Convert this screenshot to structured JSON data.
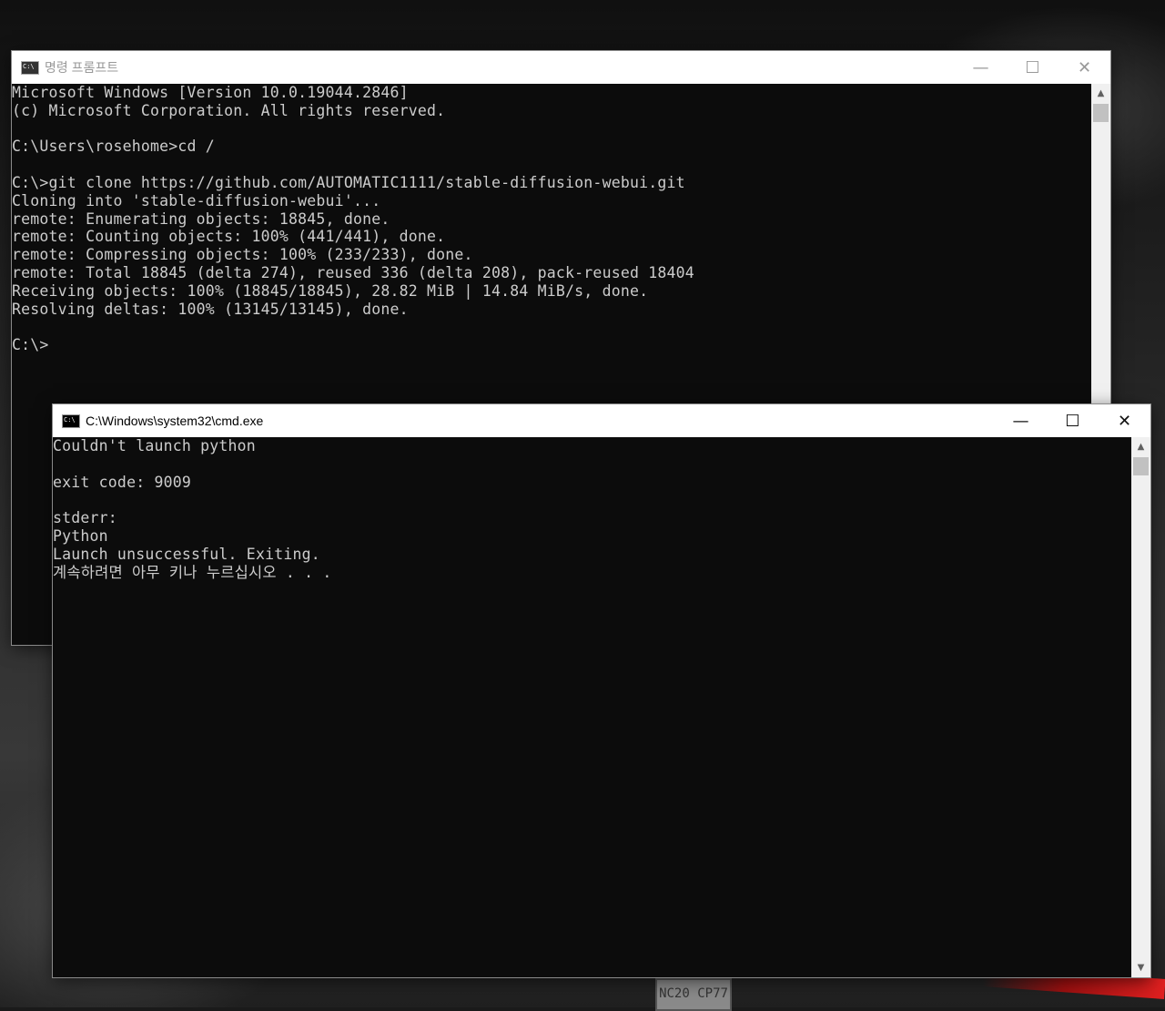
{
  "back_window": {
    "title": "명령 프롬프트",
    "controls": {
      "minimize": "—",
      "maximize": "☐",
      "close": "✕"
    },
    "lines": [
      "Microsoft Windows [Version 10.0.19044.2846]",
      "(c) Microsoft Corporation. All rights reserved.",
      "",
      "C:\\Users\\rosehome>cd /",
      "",
      "C:\\>git clone https://github.com/AUTOMATIC1111/stable-diffusion-webui.git",
      "Cloning into 'stable-diffusion-webui'...",
      "remote: Enumerating objects: 18845, done.",
      "remote: Counting objects: 100% (441/441), done.",
      "remote: Compressing objects: 100% (233/233), done.",
      "remote: Total 18845 (delta 274), reused 336 (delta 208), pack-reused 18404",
      "Receiving objects: 100% (18845/18845), 28.82 MiB | 14.84 MiB/s, done.",
      "Resolving deltas: 100% (13145/13145), done.",
      "",
      "C:\\>"
    ]
  },
  "front_window": {
    "title": "C:\\Windows\\system32\\cmd.exe",
    "controls": {
      "minimize": "—",
      "maximize": "☐",
      "close": "✕"
    },
    "lines": [
      "Couldn't launch python",
      "",
      "exit code: 9009",
      "",
      "stderr:",
      "Python",
      "Launch unsuccessful. Exiting.",
      "계속하려면 아무 키나 누르십시오 . . ."
    ]
  },
  "scrollbar": {
    "up_arrow": "▲",
    "down_arrow": "▼"
  },
  "background": {
    "plate_text": "NC20 CP77"
  },
  "colors": {
    "console_bg": "#0c0c0c",
    "console_text": "#cccccc",
    "titlebar_bg": "#ffffff",
    "inactive_title": "#999999"
  }
}
